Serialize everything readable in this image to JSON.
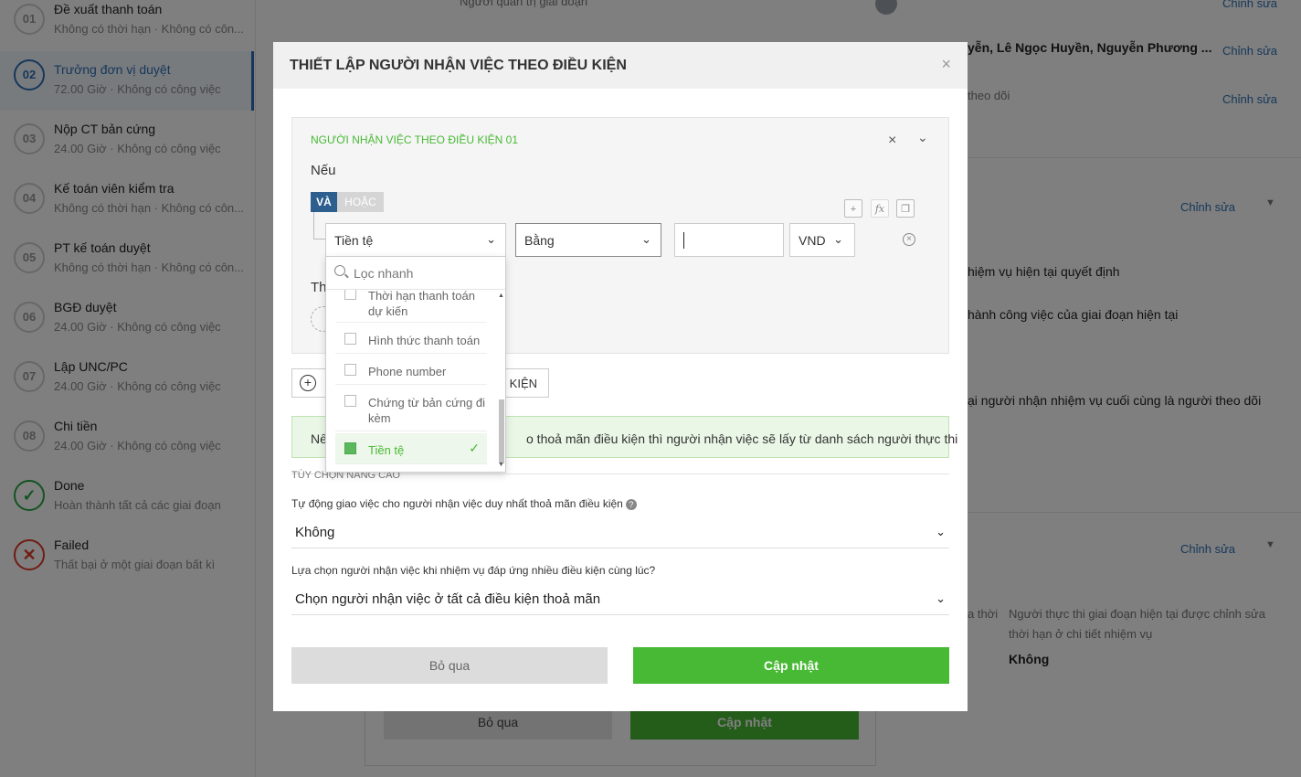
{
  "sidebar": {
    "stages": [
      {
        "num": "01",
        "title": "Đề xuất thanh toán",
        "sub": "Không có thời hạn · Không có côn..."
      },
      {
        "num": "02",
        "title": "Trưởng đơn vị duyệt",
        "sub": "72.00 Giờ · Không có công việc"
      },
      {
        "num": "03",
        "title": "Nộp CT bản cứng",
        "sub": "24.00 Giờ · Không có công việc"
      },
      {
        "num": "04",
        "title": "Kế toán viên kiểm tra",
        "sub": "Không có thời hạn · Không có côn..."
      },
      {
        "num": "05",
        "title": "PT kế toán duyệt",
        "sub": "Không có thời hạn · Không có côn..."
      },
      {
        "num": "06",
        "title": "BGĐ duyệt",
        "sub": "24.00 Giờ · Không có công việc"
      },
      {
        "num": "07",
        "title": "Lập UNC/PC",
        "sub": "24.00 Giờ · Không có công việc"
      },
      {
        "num": "08",
        "title": "Chi tiền",
        "sub": "24.00 Giờ · Không có công việc"
      },
      {
        "num": "✓",
        "title": "Done",
        "sub": "Hoàn thành tất cả các giai đoạn"
      },
      {
        "num": "✕",
        "title": "Failed",
        "sub": "Thất bại ở một giai đoạn bất kì"
      }
    ]
  },
  "background": {
    "top_gray": "Người quản trị giai đoạn",
    "names": "yễn, Lê Ngọc Huyền, Nguyễn Phương ...",
    "follow": "theo dõi",
    "edit": "Chỉnh sửa",
    "line1": "hiệm vụ hiện tại quyết định",
    "line2": "hành công việc của giai đoạn hiện tại",
    "line3": "ại người nhận nhiệm vụ cuối cùng là người theo dõi",
    "gray_a": "a thời",
    "gray_b": "Người thực thi giai đoạn hiện tại được chỉnh sửa",
    "gray_c": "thời hạn ở chi tiết nhiệm vụ",
    "no": "Không",
    "skip": "Bỏ qua",
    "update": "Cập nhật"
  },
  "modal": {
    "title": "THIẾT LẬP NGƯỜI NHẬN VIỆC THEO ĐIỀU KIỆN",
    "close_symbol": "×",
    "condition": {
      "title": "NGƯỜI NHẬN VIỆC THEO ĐIỀU KIỆN 01",
      "if_label": "Nếu",
      "then_label": "Th",
      "and_label": "VÀ",
      "or_label": "HOẶC",
      "field_value": "Tiền tệ",
      "operator_value": "Bằng",
      "input_value": "",
      "unit_value": "VND"
    },
    "add_condition_suffix": "U KIỆN",
    "info_prefix": "Nế",
    "info_text": "o thoả mãn điều kiện thì người nhận việc sẽ lấy từ danh sách người thực thi",
    "advanced_title": "TÙY CHỌN NÂNG CAO",
    "q1_label": "Tự động giao việc cho người nhận việc duy nhất thoả mãn điều kiện",
    "q1_value": "Không",
    "q2_label": "Lựa chọn người nhận việc khi nhiệm vụ đáp ứng nhiều điều kiện cùng lúc?",
    "q2_value": "Chọn người nhận việc ở tất cả điều kiện thoả mãn",
    "skip_label": "Bỏ qua",
    "update_label": "Cập nhật"
  },
  "dropdown": {
    "placeholder": "Lọc nhanh",
    "items": [
      {
        "label": "Thời hạn thanh toán dự kiến",
        "selected": false
      },
      {
        "label": "Hình thức thanh toán",
        "selected": false
      },
      {
        "label": "Phone number",
        "selected": false
      },
      {
        "label": "Chứng từ bản cứng đi kèm",
        "selected": false
      },
      {
        "label": "Tiền tệ",
        "selected": true
      }
    ]
  },
  "colors": {
    "primary_green": "#48b935",
    "primary_blue": "#2c6fb6",
    "and_toggle": "#2c5f8e"
  }
}
